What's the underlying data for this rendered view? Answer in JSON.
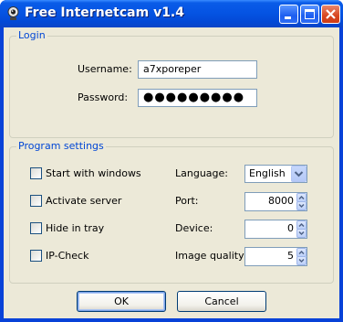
{
  "window": {
    "title": "Free Internetcam v1.4",
    "icon": "webcam-icon",
    "controls": [
      "minimize-icon",
      "maximize-icon",
      "close-icon"
    ]
  },
  "login": {
    "group_title": "Login",
    "username_label": "Username:",
    "username_value": "a7xporeper",
    "password_label": "Password:",
    "password_value": "●●●●●●●●●"
  },
  "program_settings": {
    "group_title": "Program settings",
    "checkboxes": [
      {
        "label": "Start with windows",
        "checked": false
      },
      {
        "label": "Activate server",
        "checked": false
      },
      {
        "label": "Hide in tray",
        "checked": false
      },
      {
        "label": "IP-Check",
        "checked": false
      }
    ],
    "language_label": "Language:",
    "language_value": "English",
    "port_label": "Port:",
    "port_value": "8000",
    "device_label": "Device:",
    "device_value": "0",
    "quality_label": "Image quality:",
    "quality_value": "5"
  },
  "buttons": {
    "ok": "OK",
    "cancel": "Cancel"
  },
  "colors": {
    "titlebar": "#0554e3",
    "group_title": "#0046d5",
    "dialog_bg": "#ece9d8"
  }
}
